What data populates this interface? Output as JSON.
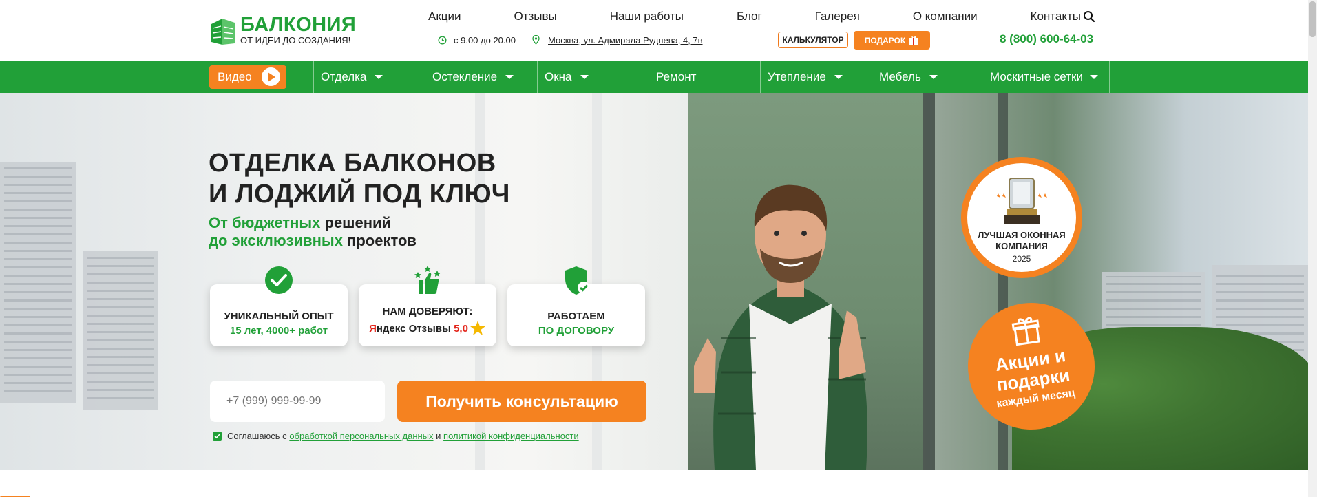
{
  "header": {
    "logo_name": "БАЛКОНИЯ",
    "logo_slogan": "ОТ ИДЕИ ДО СОЗДАНИЯ!",
    "nav": [
      "Акции",
      "Отзывы",
      "Наши работы",
      "Блог",
      "Галерея",
      "О компании",
      "Контакты"
    ],
    "hours": "с 9.00 до 20.00",
    "address": "Москва, ул. Адмирала Руднева, 4, 7в",
    "calc_label": "КАЛЬКУЛЯТОР",
    "gift_label": "ПОДАРОК",
    "phone": "8 (800) 600-64-03"
  },
  "menu": {
    "video_label": "Видео",
    "items": [
      "Отделка",
      "Остекление",
      "Окна",
      "Ремонт",
      "Утепление",
      "Мебель",
      "Москитные сетки"
    ]
  },
  "hero": {
    "title_line1": "ОТДЕЛКА БАЛКОНОВ",
    "title_line2": "И ЛОДЖИЙ ПОД КЛЮЧ",
    "sub1_green": "От бюджетных",
    "sub1_rest": " решений",
    "sub2_green": "до эксклюзивных",
    "sub2_rest": " проектов",
    "cards": [
      {
        "title": "УНИКАЛЬНЫЙ ОПЫТ",
        "sub": "15 лет, 4000+ работ"
      },
      {
        "title": "НАМ ДОВЕРЯЮТ:",
        "ya_letter": "Я",
        "ya_rest": "ндекс Отзывы",
        "rating": "5,0"
      },
      {
        "title": "РАБОТАЕМ",
        "sub": "ПО ДОГОВОРУ"
      }
    ],
    "phone_placeholder": "+7 (999) 999-99-99",
    "cta_label": "Получить консультацию",
    "consent_prefix": "Соглашаюсь с",
    "consent_link1": "обработкой персональных данных",
    "consent_and": "и",
    "consent_link2": "политикой конфиденциальности",
    "award_title": "ЛУЧШАЯ ОКОННАЯ КОМПАНИЯ",
    "award_year": "2025",
    "promo_title": "Акции и подарки",
    "promo_sub": "каждый месяц"
  },
  "colors": {
    "brand_green": "#21a038",
    "accent_orange": "#f58220"
  }
}
